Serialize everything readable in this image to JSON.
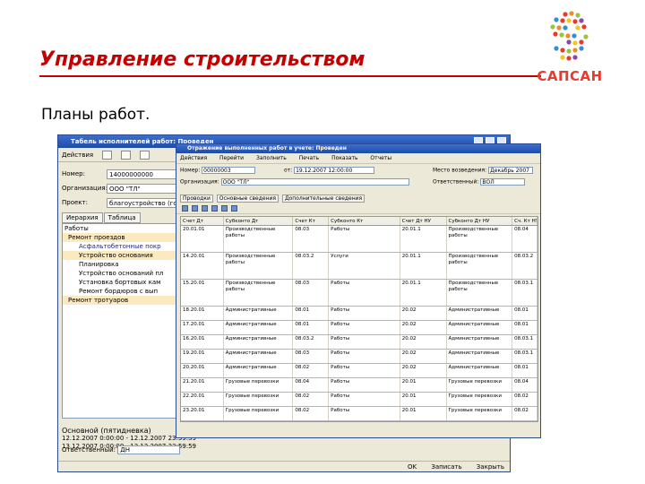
{
  "slide": {
    "title": "Управление строительством",
    "subtitle": "Планы работ."
  },
  "logo": {
    "text": "САПСАН",
    "color": "#e63b2e"
  },
  "colors": {
    "title_red": "#c40000",
    "titlebar_blue": "#2a5cc4",
    "window_bg": "#ece9d8"
  },
  "back_window": {
    "title": "Табель исполнителей работ: Проведен",
    "menu": "Действия",
    "fields": {
      "number_label": "Номер:",
      "number_value": "14000000000",
      "org_label": "Организация:",
      "org_value": "ООО \"ТЛ\"",
      "project_label": "Проект:",
      "project_value": "благоустройство (гом"
    },
    "tabs": [
      "Иерархия",
      "Таблица"
    ],
    "tree": [
      "Работы",
      "Ремонт проездов",
      "Асфальтобетонные покр",
      "Устройство основания",
      "Планировка",
      "Устройство оснований пл",
      "Установка бортовых кам",
      "Ремонт бордюров с вып",
      "Ремонт тротуаров"
    ],
    "bottom_title": "Основной (пятидневка)",
    "bottom_dates": "12.12.2007 0:00:00 - 12.12.2007 23:59:59",
    "bottom_dates_2": "13.12.2007 0:00:00 - 13.12.2007 23:59:59",
    "comment_label": "Ответственный:",
    "comment_value": "ДН",
    "status": "OK Записать Закрыть"
  },
  "front_window": {
    "title": "Отражение выполненных работ в учете: Проведен",
    "menu": [
      "Действия",
      "Перейти",
      "Заполнить",
      "Печать",
      "Показать",
      "Отчеты"
    ],
    "number_label": "Номер:",
    "number_value": "00000003",
    "date_label": "от:",
    "date_value": "19.12.2007 12:00:00",
    "org_label": "Организация:",
    "org_value": "ООО \"ТЛ\"",
    "place_label": "Место возведения:",
    "place_value": "Декабрь 2007",
    "resp_label": "Ответственный:",
    "resp_value": "ВОЛ",
    "tabs": [
      "Проводки",
      "Основные сведения",
      "Дополнительные сведения"
    ],
    "columns": [
      "Счет Дт",
      "Субконто Дт",
      "Счет Кт",
      "Субконто Кт",
      "Счет Дт НУ",
      "Субконто Дт НУ",
      "Сч. Кт НУ"
    ],
    "rows": [
      [
        "20.01.01",
        "Производственные работы",
        "08.03",
        "Работы",
        "20.01.1",
        "Производственные работы",
        "08.04"
      ],
      [
        "14.20.01",
        "Производственные работы",
        "08.03.2",
        "Услуги",
        "20.01.1",
        "Производственные работы",
        "08.03.2"
      ],
      [
        "15.20.01",
        "Производственные работы",
        "08.03",
        "Работы",
        "20.01.1",
        "Производственные работы",
        "08.03.1"
      ],
      [
        "18.20.01",
        "Административные",
        "08.01",
        "Работы",
        "20.02",
        "Административные",
        "08.01"
      ],
      [
        "17.20.01",
        "Административные",
        "08.01",
        "Работы",
        "20.02",
        "Административные",
        "08.01"
      ],
      [
        "16.20.01",
        "Административные",
        "08.03.2",
        "Работы",
        "20.02",
        "Административные",
        "08.03.1"
      ],
      [
        "19.20.01",
        "Административные",
        "08.03",
        "Работы",
        "20.02",
        "Административные",
        "08.03.1"
      ],
      [
        "20.20.01",
        "Административные",
        "08.02",
        "Работы",
        "20.02",
        "Административные",
        "08.01"
      ],
      [
        "21.20.01",
        "Грузовые перевозки",
        "08.04",
        "Работы",
        "20.01",
        "Грузовые перевозки",
        "08.04"
      ],
      [
        "22.20.01",
        "Грузовые перевозки",
        "08.02",
        "Работы",
        "20.01",
        "Грузовые перевозки",
        "08.02"
      ],
      [
        "23.20.01",
        "Грузовые перевозки",
        "08.02",
        "Работы",
        "20.01",
        "Грузовые перевозки",
        "08.02"
      ]
    ]
  }
}
